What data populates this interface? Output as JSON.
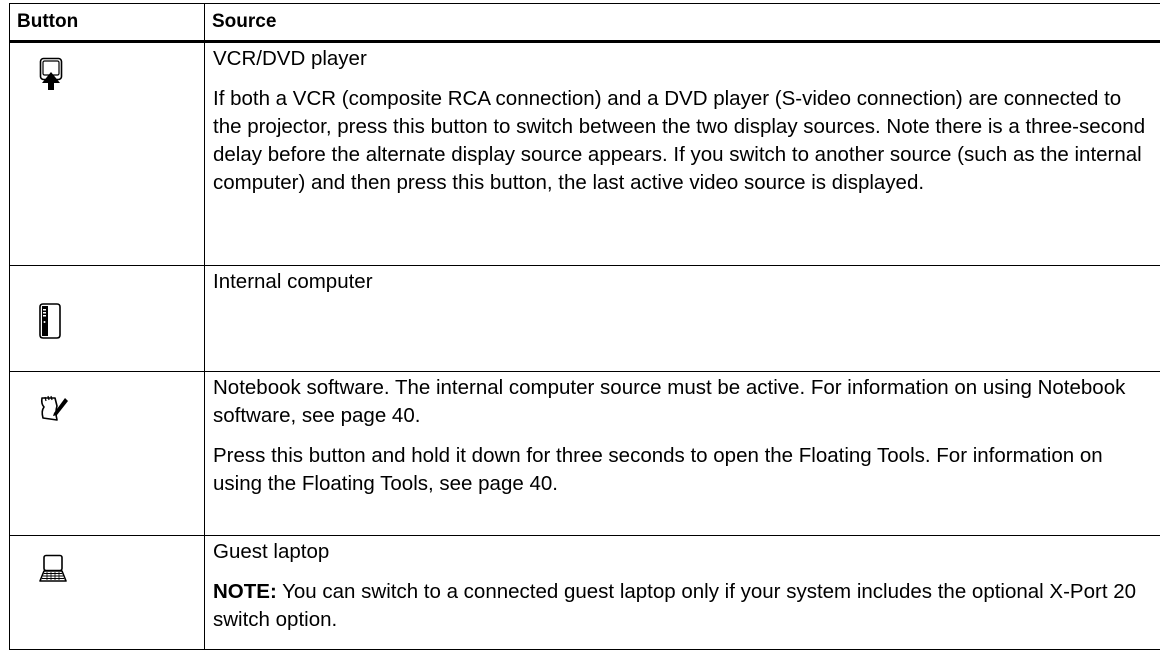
{
  "table": {
    "headers": [
      "Button",
      "Source"
    ],
    "rows": [
      {
        "icon": "vcr-dvd-icon",
        "title": "VCR/DVD player",
        "paragraph": "If both a VCR (composite RCA connection) and a DVD player (S-video connection) are connected to the projector, press this button to switch between the two display sources. Note there is a three-second delay before the alternate display source appears. If you switch to another source (such as the internal computer) and then press this button, the last active video source is displayed."
      },
      {
        "icon": "internal-computer-icon",
        "title": "Internal computer"
      },
      {
        "icon": "notebook-software-icon",
        "title": "Notebook software. The internal computer source must be active. For information on using Notebook software, see page 40.",
        "paragraph": "Press this button and hold it down for three seconds to open the Floating Tools. For information on using the Floating Tools, see page 40."
      },
      {
        "icon": "guest-laptop-icon",
        "title": "Guest laptop",
        "note_label": "NOTE:",
        "note_text": " You can switch to a connected guest laptop only if your system includes the optional X-Port 20 switch option."
      }
    ]
  }
}
